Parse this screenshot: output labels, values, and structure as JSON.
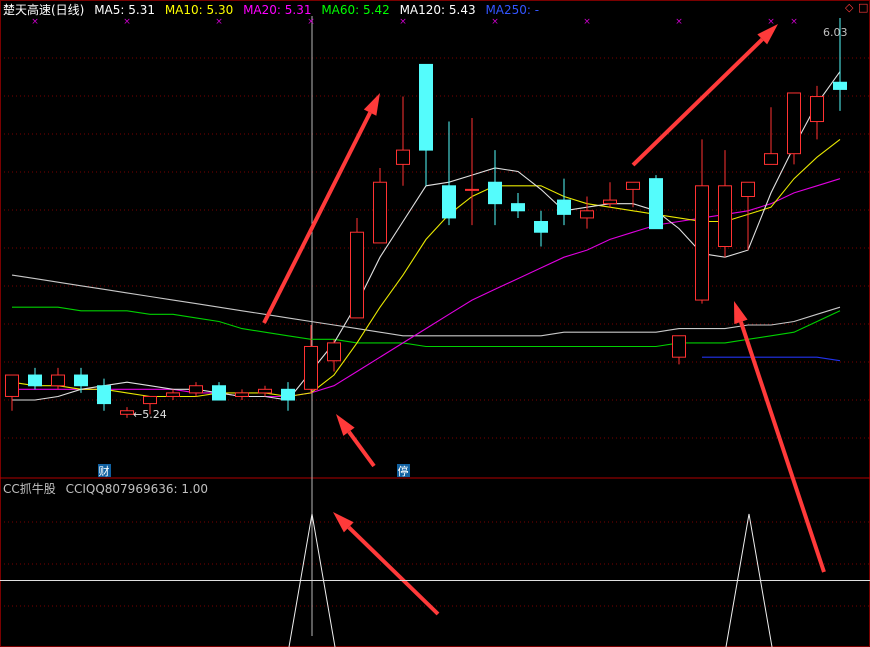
{
  "header": {
    "stock_name": "楚天高速(日线)",
    "ma": [
      {
        "label": "MA5: 5.31",
        "color": "#ffffff"
      },
      {
        "label": "MA10: 5.30",
        "color": "#ffff00"
      },
      {
        "label": "MA20: 5.31",
        "color": "#ff00ff"
      },
      {
        "label": "MA60: 5.42",
        "color": "#00ff00"
      },
      {
        "label": "MA120: 5.43",
        "color": "#ffffff"
      },
      {
        "label": "MA250: -",
        "color": "#3355ff"
      }
    ],
    "corner_icons": [
      "diamond-icon",
      "square-icon"
    ]
  },
  "indicator": {
    "name": "CC抓牛股",
    "value_label": "CCIQQ807969636: 1.00"
  },
  "colors": {
    "up": "#ff3232",
    "down": "#54fcfc",
    "grid": "#7a0000",
    "arrow": "#ff3a3a",
    "marker": "#d000d0",
    "ma5": "#e0e0e0",
    "ma10": "#e8e800",
    "ma20": "#e000e0",
    "ma60": "#00d000",
    "ma120": "#c8c8c8",
    "ma250": "#2233ee"
  },
  "chart_data": {
    "type": "candlestick",
    "ylim": [
      4.92,
      6.2
    ],
    "candles": [
      {
        "o": 5.14,
        "h": 5.2,
        "l": 5.1,
        "c": 5.2
      },
      {
        "o": 5.2,
        "h": 5.22,
        "l": 5.16,
        "c": 5.17
      },
      {
        "o": 5.17,
        "h": 5.22,
        "l": 5.16,
        "c": 5.2
      },
      {
        "o": 5.2,
        "h": 5.22,
        "l": 5.15,
        "c": 5.17
      },
      {
        "o": 5.17,
        "h": 5.19,
        "l": 5.1,
        "c": 5.12
      },
      {
        "o": 5.09,
        "h": 5.11,
        "l": 5.08,
        "c": 5.1
      },
      {
        "o": 5.12,
        "h": 5.14,
        "l": 5.09,
        "c": 5.14
      },
      {
        "o": 5.14,
        "h": 5.16,
        "l": 5.13,
        "c": 5.15
      },
      {
        "o": 5.15,
        "h": 5.18,
        "l": 5.14,
        "c": 5.17
      },
      {
        "o": 5.17,
        "h": 5.18,
        "l": 5.13,
        "c": 5.13
      },
      {
        "o": 5.14,
        "h": 5.16,
        "l": 5.13,
        "c": 5.15
      },
      {
        "o": 5.15,
        "h": 5.17,
        "l": 5.14,
        "c": 5.16
      },
      {
        "o": 5.16,
        "h": 5.18,
        "l": 5.1,
        "c": 5.13
      },
      {
        "o": 5.16,
        "h": 5.34,
        "l": 5.15,
        "c": 5.28
      },
      {
        "o": 5.24,
        "h": 5.3,
        "l": 5.21,
        "c": 5.29
      },
      {
        "o": 5.36,
        "h": 5.64,
        "l": 5.36,
        "c": 5.6
      },
      {
        "o": 5.57,
        "h": 5.78,
        "l": 5.57,
        "c": 5.74
      },
      {
        "o": 5.79,
        "h": 5.98,
        "l": 5.73,
        "c": 5.83
      },
      {
        "o": 6.07,
        "h": 6.07,
        "l": 5.73,
        "c": 5.83
      },
      {
        "o": 5.73,
        "h": 5.91,
        "l": 5.62,
        "c": 5.64
      },
      {
        "o": 5.72,
        "h": 5.92,
        "l": 5.62,
        "c": 5.72
      },
      {
        "o": 5.74,
        "h": 5.83,
        "l": 5.62,
        "c": 5.68
      },
      {
        "o": 5.68,
        "h": 5.71,
        "l": 5.64,
        "c": 5.66
      },
      {
        "o": 5.63,
        "h": 5.66,
        "l": 5.56,
        "c": 5.6
      },
      {
        "o": 5.69,
        "h": 5.75,
        "l": 5.62,
        "c": 5.65
      },
      {
        "o": 5.64,
        "h": 5.7,
        "l": 5.61,
        "c": 5.66
      },
      {
        "o": 5.68,
        "h": 5.74,
        "l": 5.67,
        "c": 5.69
      },
      {
        "o": 5.72,
        "h": 5.74,
        "l": 5.67,
        "c": 5.74
      },
      {
        "o": 5.75,
        "h": 5.76,
        "l": 5.61,
        "c": 5.61
      },
      {
        "o": 5.25,
        "h": 5.31,
        "l": 5.23,
        "c": 5.31
      },
      {
        "o": 5.41,
        "h": 5.86,
        "l": 5.4,
        "c": 5.73
      },
      {
        "o": 5.56,
        "h": 5.83,
        "l": 5.53,
        "c": 5.73
      },
      {
        "o": 5.7,
        "h": 5.74,
        "l": 5.55,
        "c": 5.74
      },
      {
        "o": 5.79,
        "h": 5.95,
        "l": 5.79,
        "c": 5.82
      },
      {
        "o": 5.82,
        "h": 5.95,
        "l": 5.79,
        "c": 5.99
      },
      {
        "o": 5.91,
        "h": 6.01,
        "l": 5.86,
        "c": 5.98
      },
      {
        "o": 6.02,
        "h": 6.2,
        "l": 5.94,
        "c": 6.0
      }
    ],
    "ma5": [
      5.13,
      5.13,
      5.14,
      5.16,
      5.17,
      5.18,
      5.17,
      5.16,
      5.16,
      5.15,
      5.14,
      5.14,
      5.13,
      5.21,
      5.29,
      5.4,
      5.53,
      5.63,
      5.73,
      5.74,
      5.76,
      5.78,
      5.77,
      5.72,
      5.66,
      5.67,
      5.68,
      5.68,
      5.66,
      5.61,
      5.54,
      5.53,
      5.55,
      5.71,
      5.84,
      5.96,
      6.05
    ],
    "ma10": [
      5.18,
      5.17,
      5.17,
      5.16,
      5.16,
      5.15,
      5.14,
      5.14,
      5.14,
      5.15,
      5.15,
      5.15,
      5.14,
      5.15,
      5.2,
      5.29,
      5.39,
      5.48,
      5.58,
      5.65,
      5.7,
      5.73,
      5.73,
      5.73,
      5.7,
      5.68,
      5.67,
      5.66,
      5.65,
      5.64,
      5.63,
      5.63,
      5.65,
      5.67,
      5.75,
      5.81,
      5.86
    ],
    "ma20": [
      5.16,
      5.16,
      5.16,
      5.16,
      5.16,
      5.16,
      5.16,
      5.16,
      5.15,
      5.15,
      5.14,
      5.14,
      5.14,
      5.15,
      5.17,
      5.21,
      5.25,
      5.29,
      5.33,
      5.37,
      5.41,
      5.44,
      5.47,
      5.5,
      5.53,
      5.55,
      5.58,
      5.6,
      5.62,
      5.63,
      5.64,
      5.65,
      5.66,
      5.68,
      5.71,
      5.73,
      5.75
    ],
    "ma60": [
      5.39,
      5.39,
      5.39,
      5.38,
      5.38,
      5.38,
      5.37,
      5.37,
      5.36,
      5.35,
      5.33,
      5.32,
      5.31,
      5.3,
      5.3,
      5.29,
      5.29,
      5.29,
      5.28,
      5.28,
      5.28,
      5.28,
      5.28,
      5.28,
      5.28,
      5.28,
      5.28,
      5.28,
      5.28,
      5.29,
      5.29,
      5.29,
      5.3,
      5.31,
      5.32,
      5.35,
      5.38
    ],
    "ma120": [
      5.48,
      5.47,
      5.46,
      5.45,
      5.44,
      5.43,
      5.42,
      5.41,
      5.4,
      5.39,
      5.38,
      5.37,
      5.36,
      5.35,
      5.34,
      5.33,
      5.32,
      5.31,
      5.31,
      5.31,
      5.31,
      5.31,
      5.31,
      5.31,
      5.32,
      5.32,
      5.32,
      5.32,
      5.32,
      5.33,
      5.33,
      5.33,
      5.34,
      5.34,
      5.35,
      5.37,
      5.39
    ],
    "ma250": [
      null,
      null,
      null,
      null,
      null,
      null,
      null,
      null,
      null,
      null,
      null,
      null,
      null,
      null,
      null,
      null,
      null,
      null,
      null,
      null,
      null,
      null,
      null,
      null,
      null,
      null,
      null,
      null,
      null,
      null,
      5.25,
      5.25,
      5.25,
      5.25,
      5.25,
      5.25,
      5.24
    ],
    "annotations": [
      {
        "text": "←5.24",
        "index": 5,
        "y": 5.08,
        "color": "#e0e0e0"
      },
      {
        "text": "6.03",
        "index": 35,
        "y": 6.15,
        "color": "#c0c0c0"
      }
    ],
    "badges": [
      {
        "text": "财",
        "index": 4
      },
      {
        "text": "停",
        "index": 17
      }
    ],
    "top_markers": [
      1,
      5,
      9,
      13,
      17,
      21,
      25,
      29,
      33,
      34
    ],
    "indicator": {
      "ylim": [
        0,
        1.15
      ],
      "spikes": [
        13,
        32
      ],
      "baseline": 0.5
    }
  }
}
